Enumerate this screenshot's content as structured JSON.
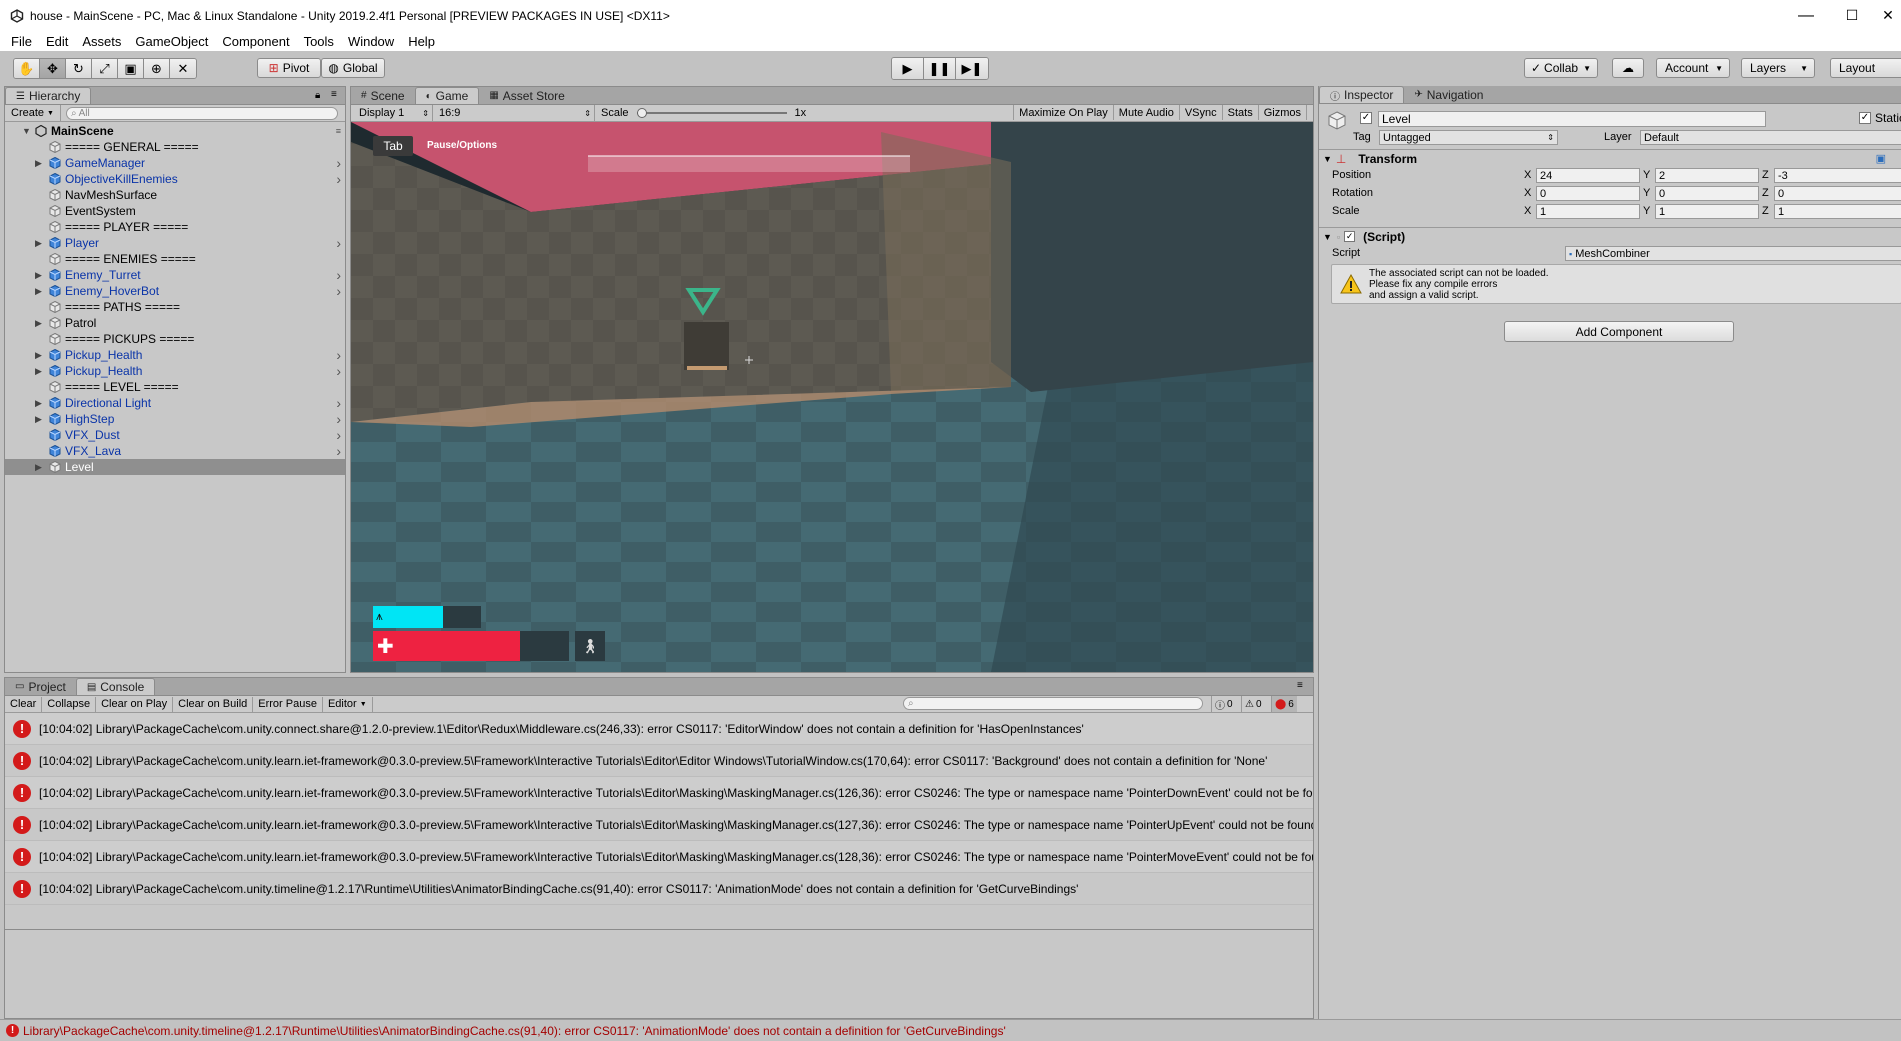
{
  "window": {
    "title": "house - MainScene - PC, Mac & Linux Standalone - Unity 2019.2.4f1 Personal [PREVIEW PACKAGES IN USE] <DX11>",
    "minimize": "—",
    "maximize": "☐",
    "close": "✕"
  },
  "menu": [
    "File",
    "Edit",
    "Assets",
    "GameObject",
    "Component",
    "Tools",
    "Window",
    "Help"
  ],
  "toolbar": {
    "pivot": "Pivot",
    "global": "Global",
    "collab": "Collab",
    "account": "Account",
    "layers": "Layers",
    "layout": "Layout"
  },
  "hierarchy": {
    "tab": "Hierarchy",
    "create": "Create",
    "search_placeholder": "All",
    "scene": "MainScene",
    "items": [
      {
        "name": "===== GENERAL =====",
        "prefab": false,
        "foldout": false,
        "chevron": false
      },
      {
        "name": "GameManager",
        "prefab": true,
        "foldout": true,
        "chevron": true
      },
      {
        "name": "ObjectiveKillEnemies",
        "prefab": true,
        "foldout": false,
        "chevron": true
      },
      {
        "name": "NavMeshSurface",
        "prefab": false,
        "foldout": false,
        "chevron": false
      },
      {
        "name": "EventSystem",
        "prefab": false,
        "foldout": false,
        "chevron": false
      },
      {
        "name": "===== PLAYER =====",
        "prefab": false,
        "foldout": false,
        "chevron": false
      },
      {
        "name": "Player",
        "prefab": true,
        "foldout": true,
        "chevron": true
      },
      {
        "name": "===== ENEMIES =====",
        "prefab": false,
        "foldout": false,
        "chevron": false
      },
      {
        "name": "Enemy_Turret",
        "prefab": true,
        "foldout": true,
        "chevron": true
      },
      {
        "name": "Enemy_HoverBot",
        "prefab": true,
        "foldout": true,
        "chevron": true
      },
      {
        "name": "===== PATHS =====",
        "prefab": false,
        "foldout": false,
        "chevron": false
      },
      {
        "name": "Patrol",
        "prefab": false,
        "foldout": true,
        "chevron": false
      },
      {
        "name": "===== PICKUPS =====",
        "prefab": false,
        "foldout": false,
        "chevron": false
      },
      {
        "name": "Pickup_Health",
        "prefab": true,
        "foldout": true,
        "chevron": true
      },
      {
        "name": "Pickup_Health",
        "prefab": true,
        "foldout": true,
        "chevron": true
      },
      {
        "name": "===== LEVEL =====",
        "prefab": false,
        "foldout": false,
        "chevron": false
      },
      {
        "name": "Directional Light",
        "prefab": true,
        "foldout": true,
        "chevron": true
      },
      {
        "name": "HighStep",
        "prefab": true,
        "foldout": true,
        "chevron": true
      },
      {
        "name": "VFX_Dust",
        "prefab": true,
        "foldout": false,
        "chevron": true
      },
      {
        "name": "VFX_Lava",
        "prefab": true,
        "foldout": false,
        "chevron": true
      },
      {
        "name": "Level",
        "prefab": false,
        "foldout": true,
        "chevron": false,
        "selected": true
      }
    ]
  },
  "center_tabs": [
    "Scene",
    "Game",
    "Asset Store"
  ],
  "game": {
    "display": "Display 1",
    "aspect": "16:9",
    "scale_label": "Scale",
    "scale_value": "1x",
    "buttons": [
      "Maximize On Play",
      "Mute Audio",
      "VSync",
      "Stats",
      "Gizmos"
    ],
    "hud_tab": "Tab",
    "hud_pause": "Pause/Options",
    "jetpack_fill": 0.65,
    "health_fill": 0.75
  },
  "inspector": {
    "tabs": [
      "Inspector",
      "Navigation"
    ],
    "object_name": "Level",
    "static_label": "Static",
    "tag_label": "Tag",
    "tag_value": "Untagged",
    "layer_label": "Layer",
    "layer_value": "Default",
    "transform_title": "Transform",
    "position_label": "Position",
    "rotation_label": "Rotation",
    "scale_label": "Scale",
    "axis_x": "X",
    "axis_y": "Y",
    "axis_z": "Z",
    "position": [
      "24",
      "2",
      "-3"
    ],
    "rotation": [
      "0",
      "0",
      "0"
    ],
    "scale": [
      "1",
      "1",
      "1"
    ],
    "script_title": "(Script)",
    "script_label": "Script",
    "script_value": "MeshCombiner",
    "warning_lines": [
      "The associated script can not be loaded.",
      "Please fix any compile errors",
      "and assign a valid script."
    ],
    "add_component": "Add Component"
  },
  "console": {
    "tabs": [
      "Project",
      "Console"
    ],
    "buttons": [
      "Clear",
      "Collapse",
      "Clear on Play",
      "Clear on Build",
      "Error Pause",
      "Editor"
    ],
    "counts": {
      "info": "0",
      "warn": "0",
      "error": "6"
    },
    "messages": [
      "[10:04:02] Library\\PackageCache\\com.unity.connect.share@1.2.0-preview.1\\Editor\\Redux\\Middleware.cs(246,33): error CS0117: 'EditorWindow' does not contain a definition for 'HasOpenInstances'",
      "[10:04:02] Library\\PackageCache\\com.unity.learn.iet-framework@0.3.0-preview.5\\Framework\\Interactive Tutorials\\Editor\\Editor Windows\\TutorialWindow.cs(170,64): error CS0117: 'Background' does not contain a definition for 'None'",
      "[10:04:02] Library\\PackageCache\\com.unity.learn.iet-framework@0.3.0-preview.5\\Framework\\Interactive Tutorials\\Editor\\Masking\\MaskingManager.cs(126,36): error CS0246: The type or namespace name 'PointerDownEvent' could not be found",
      "[10:04:02] Library\\PackageCache\\com.unity.learn.iet-framework@0.3.0-preview.5\\Framework\\Interactive Tutorials\\Editor\\Masking\\MaskingManager.cs(127,36): error CS0246: The type or namespace name 'PointerUpEvent' could not be found",
      "[10:04:02] Library\\PackageCache\\com.unity.learn.iet-framework@0.3.0-preview.5\\Framework\\Interactive Tutorials\\Editor\\Masking\\MaskingManager.cs(128,36): error CS0246: The type or namespace name 'PointerMoveEvent' could not be found",
      "[10:04:02] Library\\PackageCache\\com.unity.timeline@1.2.17\\Runtime\\Utilities\\AnimatorBindingCache.cs(91,40): error CS0117: 'AnimationMode' does not contain a definition for 'GetCurveBindings'"
    ]
  },
  "status": "Library\\PackageCache\\com.unity.timeline@1.2.17\\Runtime\\Utilities\\AnimatorBindingCache.cs(91,40): error CS0117: 'AnimationMode' does not contain a definition for 'GetCurveBindings'"
}
